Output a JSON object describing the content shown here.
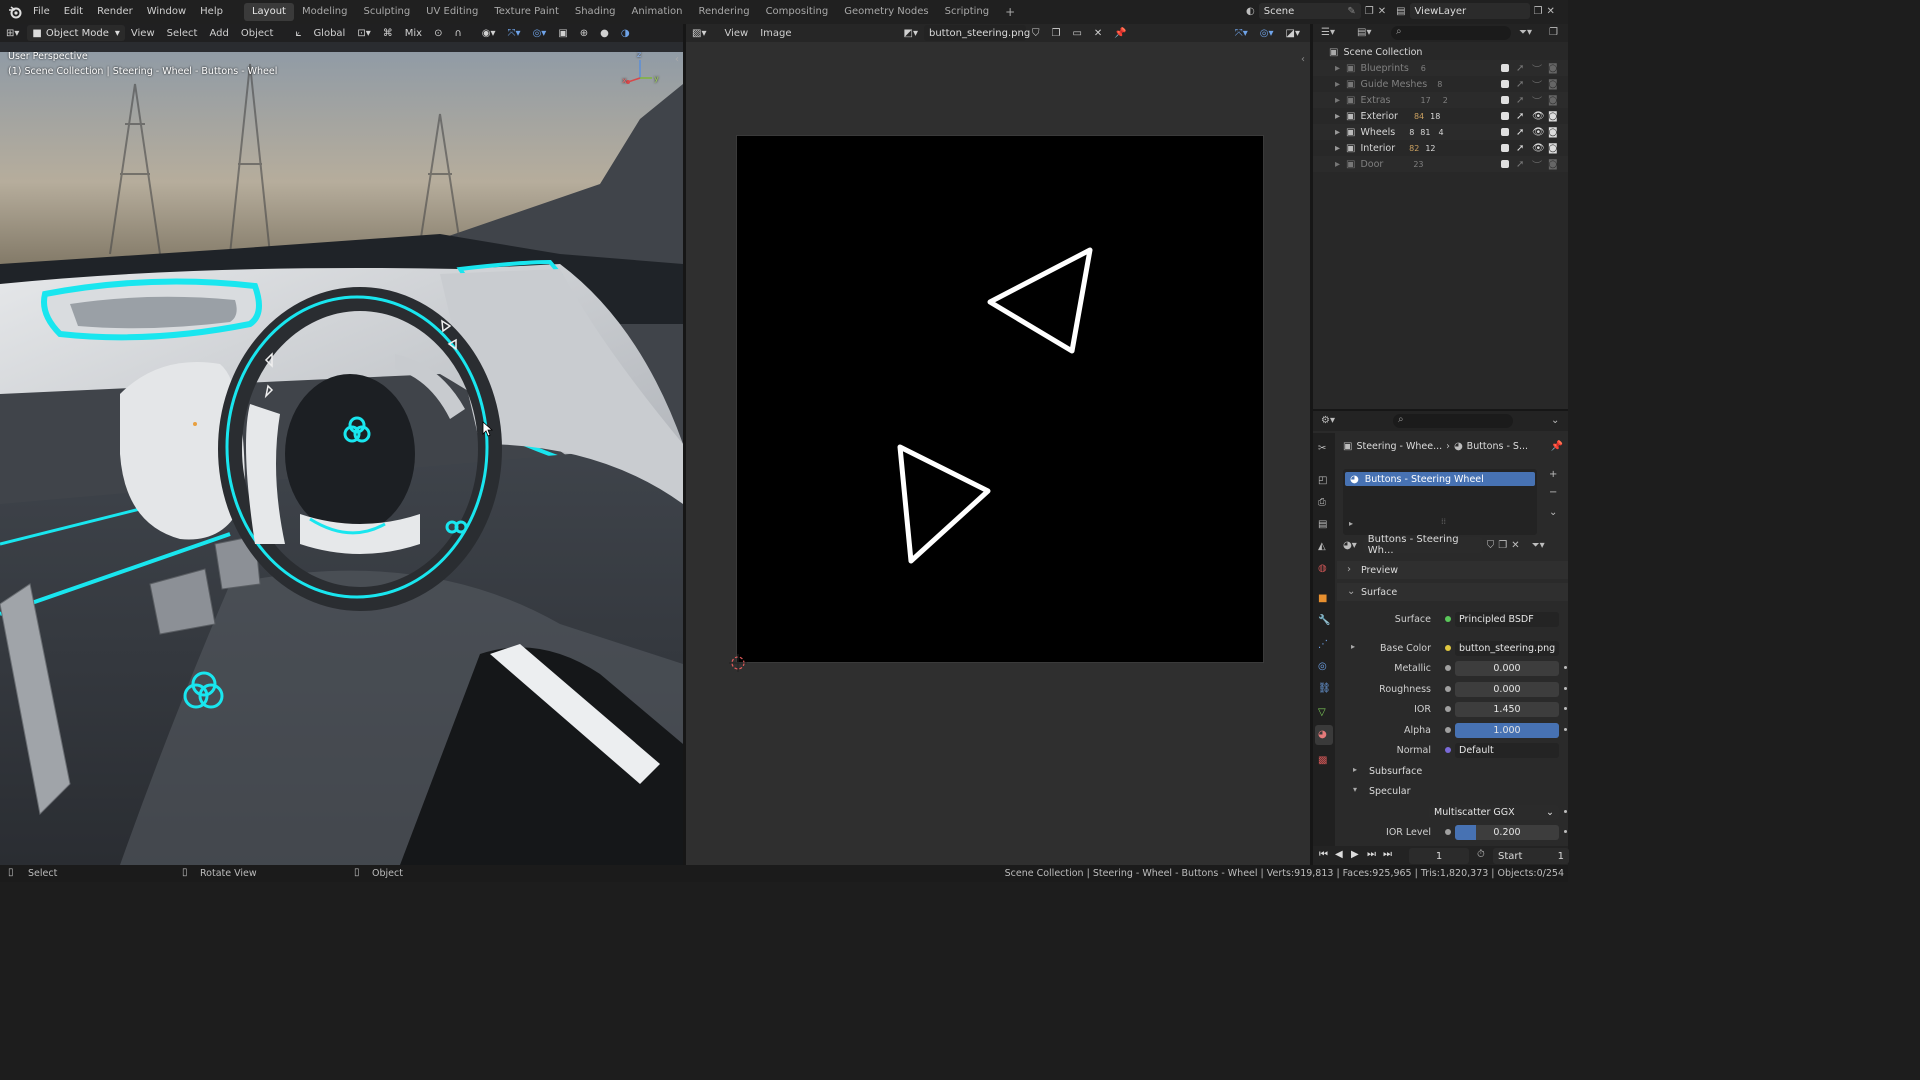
{
  "topbar": {
    "menus": [
      "File",
      "Edit",
      "Render",
      "Window",
      "Help"
    ],
    "workspaces": [
      "Layout",
      "Modeling",
      "Sculpting",
      "UV Editing",
      "Texture Paint",
      "Shading",
      "Animation",
      "Rendering",
      "Compositing",
      "Geometry Nodes",
      "Scripting"
    ],
    "active_workspace": "Layout",
    "add_workspace": "+",
    "scene": "Scene",
    "view_layer": "ViewLayer"
  },
  "viewport": {
    "mode": "Object Mode",
    "menus": [
      "View",
      "Select",
      "Add",
      "Object"
    ],
    "transform_orientation": "Global",
    "snap_mode": "Mix",
    "overlay_title": "User Perspective",
    "overlay_context": "(1) Scene Collection | Steering - Wheel - Buttons - Wheel",
    "axis_x": "x",
    "axis_y": "y",
    "axis_z": "z"
  },
  "image_editor": {
    "menus": [
      "View",
      "Image"
    ],
    "image_name": "button_steering.png"
  },
  "outliner": {
    "root": "Scene Collection",
    "collections": [
      {
        "name": "Blueprints",
        "count": "6",
        "enabled": false
      },
      {
        "name": "Guide Meshes",
        "count": "8",
        "enabled": false
      },
      {
        "name": "Extras",
        "count": "17",
        "count2": "2",
        "enabled": false
      },
      {
        "name": "Exterior",
        "count": "84",
        "count2": "18",
        "enabled": true
      },
      {
        "name": "Wheels",
        "count": "8",
        "count2": "81",
        "count3": "4",
        "enabled": true
      },
      {
        "name": "Interior",
        "count": "82",
        "count2": "12",
        "enabled": true
      },
      {
        "name": "Door",
        "count": "23",
        "enabled": false
      }
    ]
  },
  "properties": {
    "breadcrumb_object": "Steering - Whee...",
    "breadcrumb_material": "Buttons - S...",
    "material_slot": "Buttons - Steering Wheel",
    "material_name": "Buttons - Steering Wh...",
    "panels": {
      "preview": "Preview",
      "surface": "Surface",
      "subsurface": "Subsurface",
      "specular": "Specular"
    },
    "fields": {
      "surface_label": "Surface",
      "surface_value": "Principled BSDF",
      "base_color_label": "Base Color",
      "base_color_value": "button_steering.png",
      "metallic_label": "Metallic",
      "metallic_value": "0.000",
      "roughness_label": "Roughness",
      "roughness_value": "0.000",
      "ior_label": "IOR",
      "ior_value": "1.450",
      "alpha_label": "Alpha",
      "alpha_value": "1.000",
      "normal_label": "Normal",
      "normal_value": "Default",
      "specular_distribution": "Multiscatter GGX",
      "ior_level_label": "IOR Level",
      "ior_level_value": "0.200"
    },
    "alpha_fill": 1.0,
    "ior_level_fill": 0.2
  },
  "timeline": {
    "current_frame": "1",
    "start_label": "Start",
    "start_value": "1"
  },
  "statusbar": {
    "left_select": "Select",
    "left_rotate": "Rotate View",
    "left_object": "Object",
    "info": "Scene Collection | Steering - Wheel - Buttons - Wheel | Verts:919,813 | Faces:925,965 | Tris:1,820,373 | Objects:0/254"
  },
  "colors": {
    "accent_blue": "#4772b3",
    "neon_cyan": "#19e6ef",
    "background": "#1d1d1d"
  }
}
